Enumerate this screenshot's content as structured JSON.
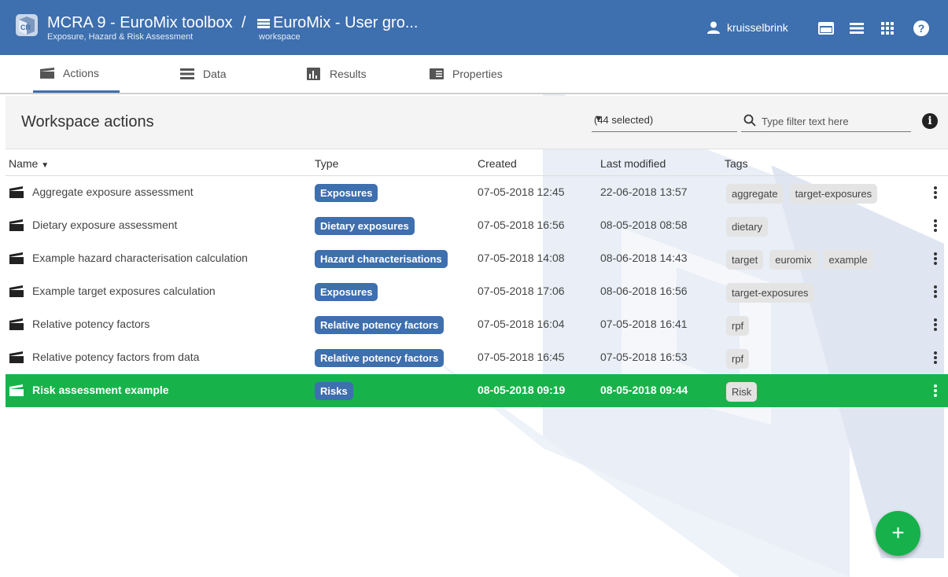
{
  "header": {
    "app_title": "MCRA 9 - EuroMix toolbox",
    "app_subtitle": "Exposure, Hazard & Risk Assessment",
    "separator": "/",
    "workspace_title": "EuroMix - User gro...",
    "workspace_subtitle": "workspace",
    "user_name": "kruisselbrink",
    "header_color": "#3e6fae"
  },
  "tabs": [
    {
      "label": "Actions",
      "icon": "clapperboard-icon",
      "active": true
    },
    {
      "label": "Data",
      "icon": "list-icon",
      "active": false
    },
    {
      "label": "Results",
      "icon": "chart-icon",
      "active": false
    },
    {
      "label": "Properties",
      "icon": "properties-icon",
      "active": false
    }
  ],
  "workspace_actions": {
    "title": "Workspace actions",
    "selection": "(44 selected)",
    "filter_placeholder": "Type filter text here"
  },
  "table": {
    "columns": [
      "Name",
      "Type",
      "Created",
      "Last modified",
      "Tags"
    ],
    "sort_column": "Name",
    "rows": [
      {
        "name": "Aggregate exposure assessment",
        "type": "Exposures",
        "created": "07-05-2018 12:45",
        "modified": "22-06-2018 13:57",
        "tags": [
          "aggregate",
          "target-exposures"
        ]
      },
      {
        "name": "Dietary exposure assessment",
        "type": "Dietary exposures",
        "created": "07-05-2018 16:56",
        "modified": "08-05-2018 08:58",
        "tags": [
          "dietary"
        ]
      },
      {
        "name": "Example hazard characterisation calculation",
        "type": "Hazard characterisations",
        "created": "07-05-2018 14:08",
        "modified": "08-06-2018 14:43",
        "tags": [
          "target",
          "euromix",
          "example"
        ]
      },
      {
        "name": "Example target exposures calculation",
        "type": "Exposures",
        "created": "07-05-2018 17:06",
        "modified": "08-06-2018 16:56",
        "tags": [
          "target-exposures"
        ]
      },
      {
        "name": "Relative potency factors",
        "type": "Relative potency factors",
        "created": "07-05-2018 16:04",
        "modified": "07-05-2018 16:41",
        "tags": [
          "rpf"
        ]
      },
      {
        "name": "Relative potency factors from data",
        "type": "Relative potency factors",
        "created": "07-05-2018 16:45",
        "modified": "07-05-2018 16:53",
        "tags": [
          "rpf"
        ]
      },
      {
        "name": "Risk assessment example",
        "type": "Risks",
        "created": "08-05-2018 09:19",
        "modified": "08-05-2018 09:44",
        "tags": [
          "Risk"
        ],
        "selected": true
      }
    ]
  },
  "fab": {
    "label": "+",
    "color": "#16b14a"
  },
  "colors": {
    "selected_row": "#17b34a",
    "badge": "#3e6fae",
    "tag_bg": "#e4e4e4"
  }
}
